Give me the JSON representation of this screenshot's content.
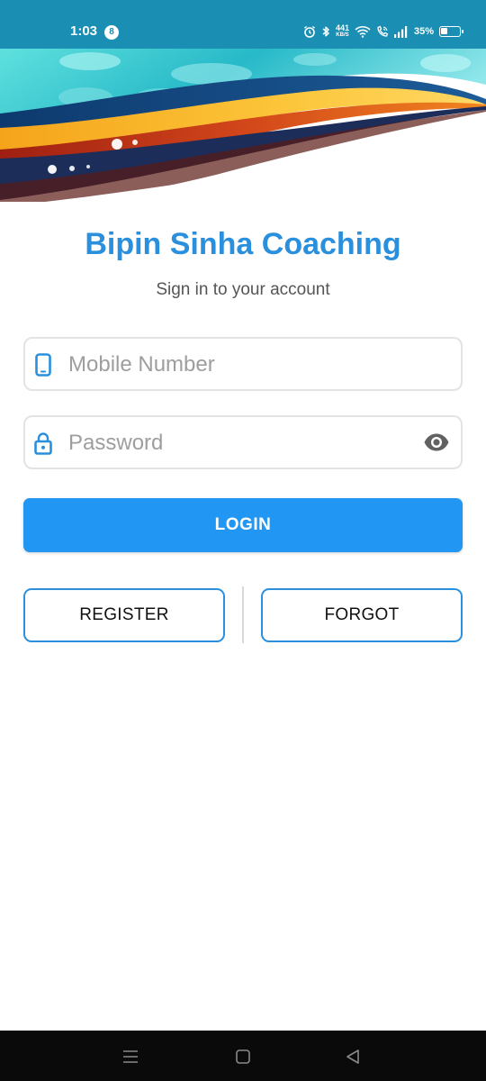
{
  "status_bar": {
    "time": "1:03",
    "notification_count": "8",
    "net_speed_value": "441",
    "net_speed_unit": "KB/S",
    "battery_percent": "35%",
    "battery_level": 0.35,
    "icons": [
      "alarm-icon",
      "bluetooth-icon",
      "wifi-icon",
      "wifi-calling-icon",
      "signal-icon",
      "battery-icon"
    ]
  },
  "app": {
    "title": "Bipin Sinha Coaching",
    "subtitle": "Sign in to your account"
  },
  "form": {
    "mobile_placeholder": "Mobile Number",
    "mobile_value": "",
    "mobile_icon": "phone-icon",
    "password_placeholder": "Password",
    "password_value": "",
    "password_icon": "lock-icon",
    "visibility_icon": "eye-icon"
  },
  "buttons": {
    "login": "LOGIN",
    "register": "REGISTER",
    "forgot": "FORGOT"
  },
  "nav_bar": {
    "icons": [
      "menu-icon",
      "home-icon",
      "back-icon"
    ]
  },
  "colors": {
    "status_bar": "#1a8fb3",
    "title": "#2a8fdc",
    "primary_button": "#2196f3",
    "outline_border": "#2a8fdc",
    "field_icon": "#2a8fdc"
  }
}
